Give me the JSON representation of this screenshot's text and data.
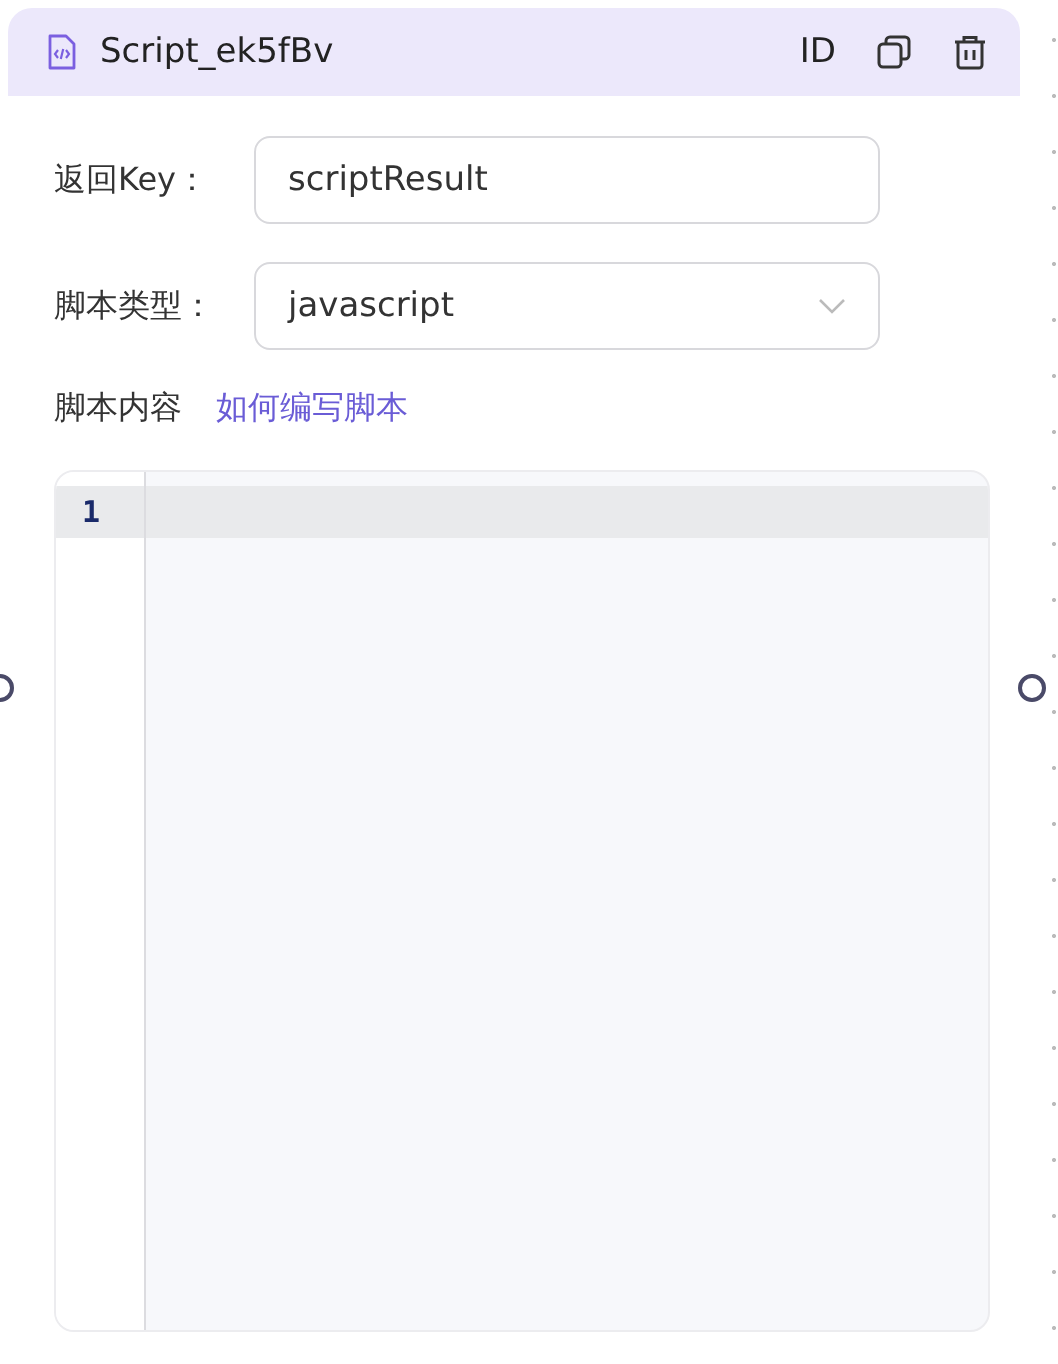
{
  "node": {
    "title": "Script_ek5fBv",
    "id_label": "ID"
  },
  "fields": [
    {
      "kind": "input",
      "label": "返回Key：",
      "value": "scriptResult"
    },
    {
      "kind": "select",
      "label": "脚本类型：",
      "value": "javascript"
    }
  ],
  "content": {
    "label": "脚本内容",
    "help_link": "如何编写脚本"
  },
  "editor": {
    "lines": [
      {
        "number": "1",
        "active": true
      }
    ]
  }
}
